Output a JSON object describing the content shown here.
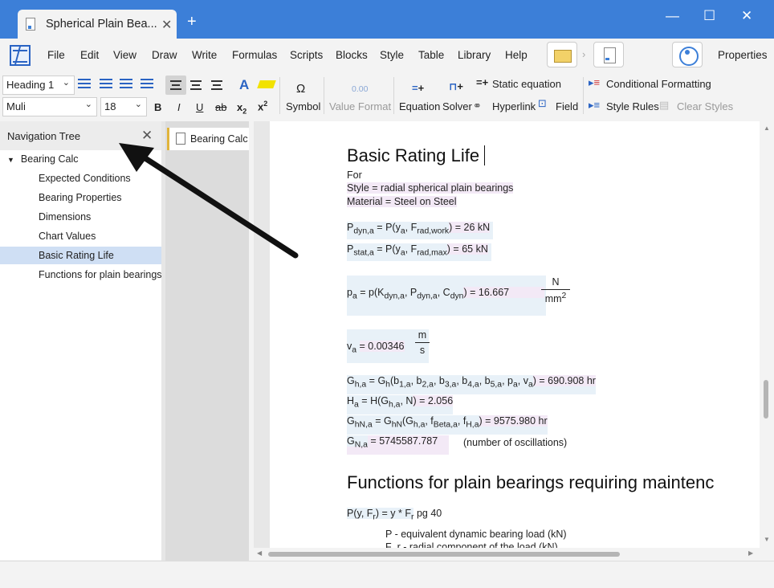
{
  "window": {
    "tab_title": "Spherical Plain Bea...",
    "new_tab": "+",
    "tab_close": "✕",
    "min": "—",
    "max": "☐",
    "close": "✕"
  },
  "menu": [
    "File",
    "Edit",
    "View",
    "Draw",
    "Write",
    "Formulas",
    "Scripts",
    "Blocks",
    "Style",
    "Table",
    "Library",
    "Help"
  ],
  "properties_label": "Properties",
  "toolbar": {
    "style_select": "Heading 1",
    "font_select": "Muli",
    "size_select": "18",
    "bold": "B",
    "italic": "I",
    "underline": "U",
    "strike": "ab",
    "subscript": "x",
    "subscript_sub": "2",
    "superscript": "x",
    "superscript_sup": "2",
    "symbol": "Symbol",
    "symbol_glyph": "Ω",
    "value_format": "Value Format",
    "value_format_glyph": "0.00",
    "equation": "Equation",
    "solver": "Solver",
    "static_equation": "Static equation",
    "hyperlink": "Hyperlink",
    "field": "Field",
    "conditional_formatting": "Conditional Formatting",
    "style_rules": "Style Rules",
    "clear_styles": "Clear Styles"
  },
  "nav": {
    "title": "Navigation Tree",
    "close": "✕",
    "root": "Bearing Calc",
    "items": [
      "Expected Conditions",
      "Bearing Properties",
      "Dimensions",
      "Chart Values",
      "Basic Rating Life",
      "Functions for plain bearings"
    ],
    "selected_index": 4
  },
  "pages": {
    "card": "Bearing Calc"
  },
  "doc": {
    "heading1": "Basic Rating Life",
    "for": "For",
    "style_line": "Style = radial spherical plain bearings",
    "material_line": "Material = Steel on Steel",
    "pdyn": "P",
    "pdyn_sub": "dyn,a",
    "pdyn_rhs": "= P(y",
    "pdyn_rhs2": ", F",
    "pdyn_rhs2_sub": "rad,work",
    "pdyn_val": ") = 26 kN",
    "pstat": "P",
    "pstat_sub": "stat,a",
    "pstat_rhs2_sub": "rad,max",
    "pstat_val": ") = 65 kN",
    "p_a_eq": "p",
    "p_a_rhs": "= p(K",
    "p_a_rhs_s1": "dyn,a",
    "p_a_rhs_mid": ", P",
    "p_a_rhs_s2": "dyn,a",
    "p_a_rhs_mid2": ", C",
    "p_a_rhs_s3": "dyn",
    "p_a_val": ") = 16.667",
    "p_a_num": "N",
    "p_a_den": "mm",
    "p_a_den_sup": "2",
    "v_a": "v",
    "v_a_val": "= 0.00346",
    "v_a_num": "m",
    "v_a_den": "s",
    "gh_line": "G",
    "gh_val": ") = 690.908 hr",
    "ha_val": ") = 2.056",
    "ghn_val": ") = 9575.980 hr",
    "gn_val": "= 5745587.787",
    "gn_note": "(number of oscillations)",
    "heading2": "Functions for plain bearings requiring maintenc",
    "pf_line": ") = y * F",
    "pf_tail": "pg 40",
    "p_desc": "P - equivalent dynamic bearing load (kN)",
    "fr_desc": "F_r - radial component of the load (kN)"
  },
  "colors": {
    "titlebar": "#3c7fd8",
    "accent": "#2a63c3",
    "selected": "#cfdff4",
    "highlight_blue": "#e8f1f8",
    "highlight_pink": "#f3e9f6"
  }
}
